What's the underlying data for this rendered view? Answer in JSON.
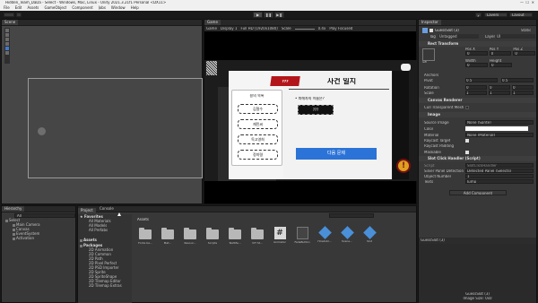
{
  "window": {
    "title": "Hidden_Team_DaDa - Select - Windows, Mac, Linux - Unity 2021.3.21f1 Personal <DX11>"
  },
  "menu": [
    "File",
    "Edit",
    "Assets",
    "GameObject",
    "Component",
    "Jobs",
    "Window",
    "Help"
  ],
  "toolbar": {
    "layers": "Layers",
    "layout": "Layout"
  },
  "scene": {
    "tab": "Scene"
  },
  "game": {
    "tab": "Game",
    "display": "Display 1",
    "resolution": "Full HD (1920x1080)",
    "scale_label": "Scale",
    "scale_value": "0.4x",
    "play_focused": "Play Focused"
  },
  "popup": {
    "badge": "???",
    "title": "사건 일지",
    "left_title": "용의 목록",
    "suspects": [
      "김철수",
      "재민씨",
      "독고영희",
      "정미령"
    ],
    "question": "• 피해자의 이름은?",
    "answer": "???",
    "next_button": "다음 문제",
    "alert": "!"
  },
  "inspector": {
    "tab": "Inspector",
    "object_name": "GuessSlot (3)",
    "static": "Static",
    "tag_label": "Tag",
    "tag_value": "Untagged",
    "layer_label": "Layer",
    "layer_value": "UI",
    "rect_transform": "Rect Transform",
    "anchor": "left",
    "pos_labels": [
      "Pos X",
      "Pos Y",
      "Pos Z"
    ],
    "pos_values": [
      "0",
      "0",
      "0"
    ],
    "wh_labels": [
      "Width",
      "Height"
    ],
    "wh_values": [
      "0",
      "0"
    ],
    "anchors": "Anchors",
    "pivot": "Pivot",
    "pivot_values": [
      "0.5",
      "0.5"
    ],
    "rotation": "Rotation",
    "rotation_values": [
      "0",
      "0",
      "0"
    ],
    "scale": "Scale",
    "scale_values": [
      "1",
      "1",
      "1"
    ],
    "canvas_renderer": "Canvas Renderer",
    "cull_mesh": "Cull Transparent Mesh",
    "image": "Image",
    "source_image": "Source Image",
    "source_value": "None (Sprite)",
    "color": "Color",
    "material": "Material",
    "material_value": "None (Material)",
    "raycast": "Raycast Target",
    "raycast_padding": "Raycast Padding",
    "maskable": "Maskable",
    "slot_handler": "Slot Click Handler (Script)",
    "script": "Script",
    "script_value": "SlotClickHandler",
    "panel_detection": "Silver Panel Detection",
    "panel_value": "Detected Panel (Selects)",
    "object_number": "Object Number",
    "object_number_value": "1",
    "texts": "Texts",
    "texts_value": "Jump",
    "add_component": "Add Component",
    "preview_name": "GuessSlot (3)",
    "preview_sub": "GuessSlot (3)",
    "preview_size": "Image Size: 0x0"
  },
  "hierarchy": {
    "tab": "Hierarchy",
    "search_placeholder": "All",
    "items": [
      "Select",
      "Main Camera",
      "Canvas",
      "EventSystem",
      "Activation"
    ]
  },
  "project": {
    "tabs": [
      "Project",
      "Console"
    ],
    "favorites": "Favorites",
    "fav_items": [
      "All Materials",
      "All Models",
      "All Prefabs"
    ],
    "assets_header": "Assets",
    "assets_tree": "Assets",
    "packages": "Packages",
    "packages_items": [
      "2D Animation",
      "2D Common",
      "2D Path",
      "2D Pixel Perfect",
      "2D PSD Importer",
      "2D Sprite",
      "2D SpriteShape",
      "2D Tilemap Editor",
      "2D Tilemap Extras"
    ],
    "grid": [
      {
        "kind": "folder",
        "label": "Fonts ba..."
      },
      {
        "kind": "folder",
        "label": "Mat..."
      },
      {
        "kind": "folder",
        "label": "Resour..."
      },
      {
        "kind": "folder",
        "label": "Scripts"
      },
      {
        "kind": "folder",
        "label": "TextMe..."
      },
      {
        "kind": "folder",
        "label": "VIT St..."
      },
      {
        "kind": "hash",
        "label": "#",
        "sub": "Animator"
      },
      {
        "kind": "script",
        "label": "FadeButton"
      },
      {
        "kind": "cube",
        "label": "Howtobl..."
      },
      {
        "kind": "cube",
        "label": "Scene..."
      },
      {
        "kind": "cube",
        "label": "Slot"
      }
    ]
  },
  "colors": {
    "accent": "#2d5f9e",
    "popup_red": "#b3161a",
    "blue_button": "#2b73d6",
    "alert": "#e0a020"
  }
}
